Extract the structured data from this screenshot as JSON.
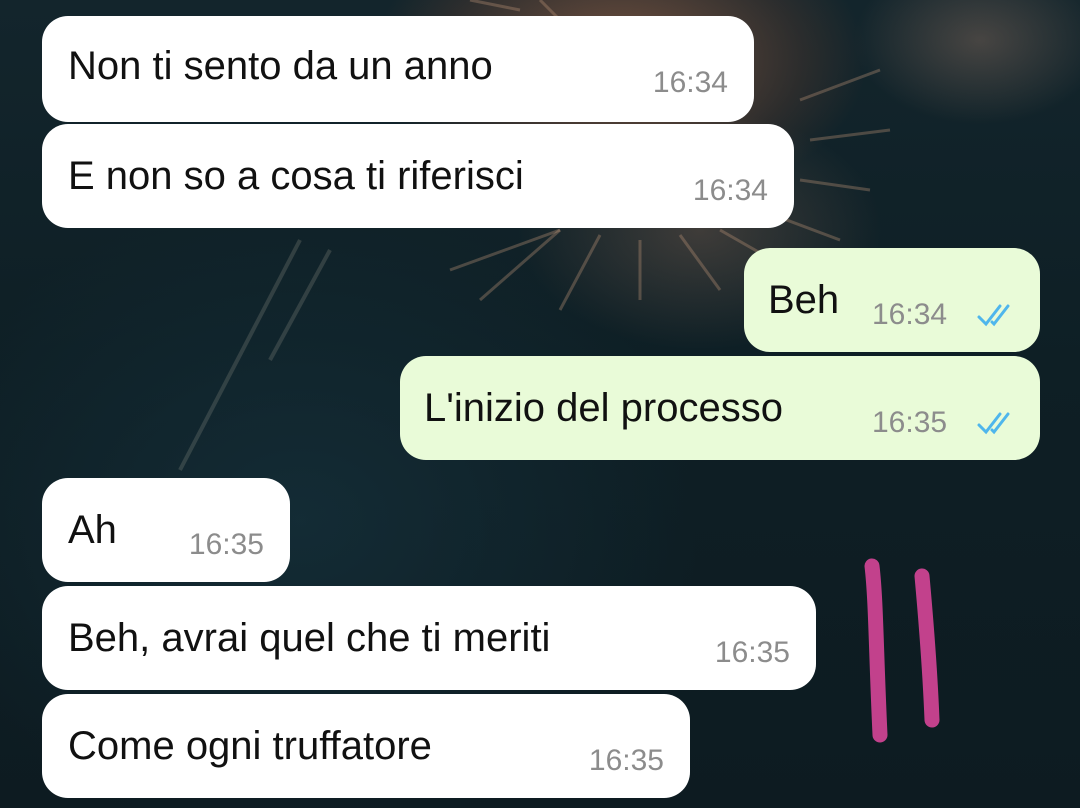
{
  "chat": {
    "messages": [
      {
        "direction": "incoming",
        "text": "Non ti sento da un anno",
        "time": "16:34"
      },
      {
        "direction": "incoming",
        "text": "E non so a cosa ti riferisci",
        "time": "16:34"
      },
      {
        "direction": "outgoing",
        "text": "Beh",
        "time": "16:34",
        "status": "read"
      },
      {
        "direction": "outgoing",
        "text": "L'inizio del processo",
        "time": "16:35",
        "status": "read"
      },
      {
        "direction": "incoming",
        "text": "Ah",
        "time": "16:35"
      },
      {
        "direction": "incoming",
        "text": "Beh, avrai quel che ti meriti",
        "time": "16:35"
      },
      {
        "direction": "incoming",
        "text": "Come ogni truffatore",
        "time": "16:35"
      }
    ]
  },
  "colors": {
    "incoming_bubble": "#ffffff",
    "outgoing_bubble": "#e9fbd8",
    "read_ticks": "#4fb6ec",
    "doodle": "#c2418c"
  },
  "icons": {
    "read_receipt": "double-check-icon"
  }
}
